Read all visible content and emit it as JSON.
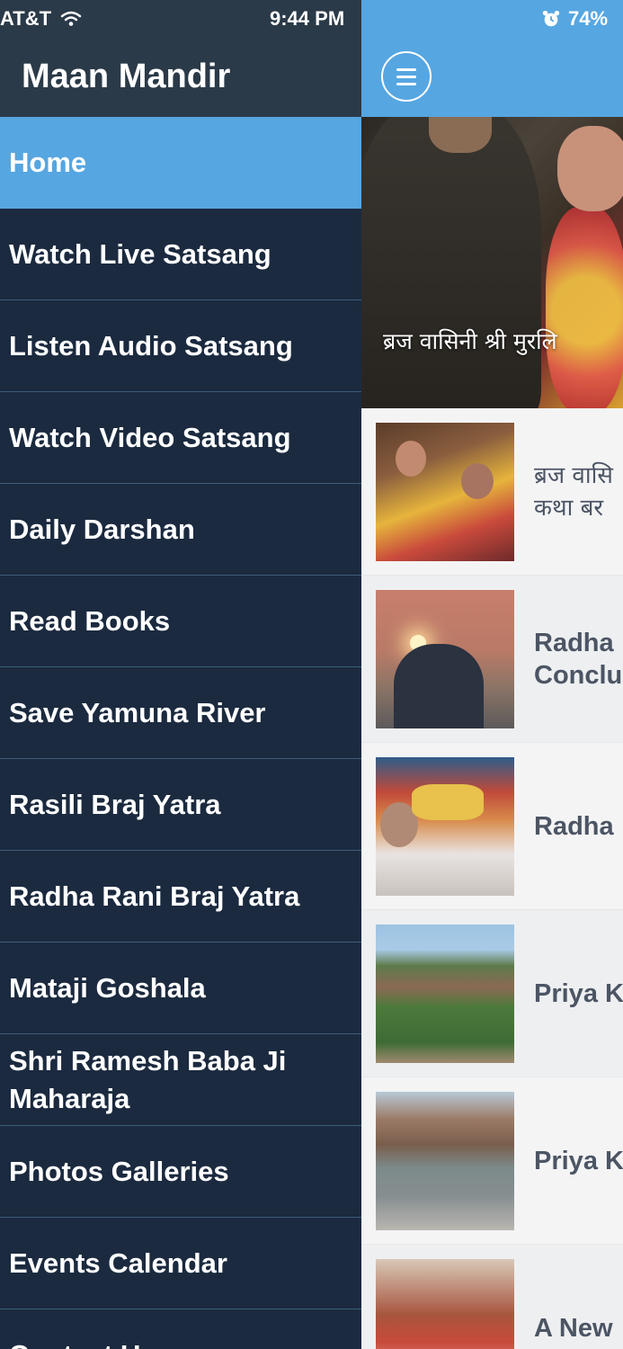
{
  "status_bar": {
    "carrier": "AT&T",
    "time": "9:44 PM",
    "battery": "74%",
    "icons": [
      "wifi-icon",
      "alarm-icon"
    ]
  },
  "drawer": {
    "title": "Maan Mandir",
    "items": [
      {
        "label": "Home",
        "active": true
      },
      {
        "label": "Watch Live Satsang"
      },
      {
        "label": "Listen Audio Satsang"
      },
      {
        "label": "Watch Video Satsang"
      },
      {
        "label": "Daily Darshan"
      },
      {
        "label": "Read Books"
      },
      {
        "label": "Save Yamuna River"
      },
      {
        "label": "Rasili Braj Yatra"
      },
      {
        "label": "Radha Rani Braj Yatra"
      },
      {
        "label": "Mataji Goshala"
      },
      {
        "label": "Shri Ramesh Baba Ji\nMaharaja"
      },
      {
        "label": "Photos Galleries"
      },
      {
        "label": "Events Calendar"
      },
      {
        "label": "Contact Us"
      }
    ]
  },
  "main": {
    "menu_icon": "hamburger-menu-icon",
    "hero_caption": "ब्रज वासिनी श्री मुरलि",
    "news": [
      {
        "title": "ब्रज वासि\nकथा बर",
        "hindi": true
      },
      {
        "title": "Radha\nConclu"
      },
      {
        "title": "Radha"
      },
      {
        "title": "Priya K"
      },
      {
        "title": "Priya K"
      },
      {
        "title": "A New"
      }
    ]
  },
  "colors": {
    "drawer_bg": "#1b2a3f",
    "drawer_header": "#2b3a48",
    "accent": "#56a6e1",
    "divider": "#3c5c7c",
    "news_title": "#4c5564"
  }
}
